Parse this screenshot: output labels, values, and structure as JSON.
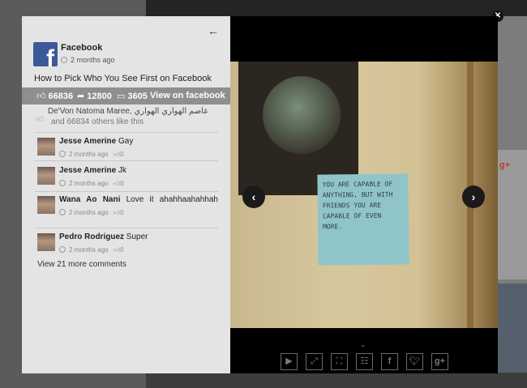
{
  "post": {
    "page_name": "Facebook",
    "time": "2 months ago",
    "title": "How to Pick Who You See First on Facebook"
  },
  "stats": {
    "likes": "66836",
    "shares": "12800",
    "comments": "3605",
    "view_link": "View on facebook"
  },
  "likes_line": {
    "names": "De'Von Natoma Maree, عاصم الهواري الهواري",
    "others": "and 66834 others like this"
  },
  "comments": [
    {
      "name": "Jesse Amerine",
      "text": "Gay",
      "time": "2 months ago",
      "likes": "0"
    },
    {
      "name": "Jesse Amerine",
      "text": "Jk",
      "time": "2 months ago",
      "likes": "0"
    },
    {
      "name": "Wana Ao Nani",
      "text": "Love it ahahhaahahhah",
      "time": "2 months ago",
      "likes": "0"
    },
    {
      "name": "Pedro Rodriguez",
      "text": "Super",
      "time": "2 months ago",
      "likes": "0"
    }
  ],
  "view_more": "View 21 more comments",
  "video": {
    "note_text": "YOU ARE CAPABLE OF ANYTHING, BUT WITH FRIENDS YOU ARE CAPABLE OF EVEN MORE."
  },
  "icons": {
    "close": "close-icon",
    "back": "back-arrow-icon",
    "prev": "chevron-left-icon",
    "next": "chevron-right-icon",
    "toolbar": [
      "play-icon",
      "expand-icon",
      "fullscreen-icon",
      "comments-icon",
      "facebook-icon",
      "twitter-icon",
      "google-plus-icon"
    ]
  },
  "colors": {
    "facebook_blue": "#3b5998",
    "stats_bar": "#8f8f8f",
    "sidebar_bg": "#e4e4e4"
  }
}
